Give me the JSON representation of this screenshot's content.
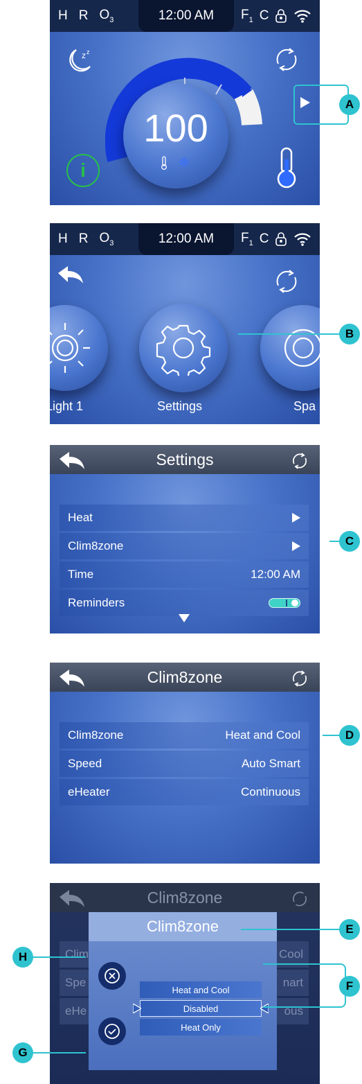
{
  "status_bar": {
    "h": "H",
    "r": "R",
    "o": "O",
    "o_sub": "3",
    "time": "12:00 AM",
    "f": "F",
    "f_sub": "1",
    "c": "C"
  },
  "screen1": {
    "temperature": "100",
    "callout": "A"
  },
  "screen2": {
    "items": [
      {
        "label": "Light 1",
        "icon": "sun-icon"
      },
      {
        "label": "Settings",
        "icon": "gear-icon"
      },
      {
        "label": "Spa",
        "icon": "spa-icon"
      }
    ],
    "callout": "B"
  },
  "screen3": {
    "title": "Settings",
    "rows": [
      {
        "label": "Heat"
      },
      {
        "label": "Clim8zone"
      },
      {
        "label": "Time",
        "value": "12:00 AM"
      },
      {
        "label": "Reminders"
      }
    ],
    "reminders_toggle": "on",
    "callout": "C"
  },
  "screen4": {
    "title": "Clim8zone",
    "rows": [
      {
        "label": "Clim8zone",
        "value": "Heat and Cool"
      },
      {
        "label": "Speed",
        "value": "Auto Smart"
      },
      {
        "label": "eHeater",
        "value": "Continuous"
      }
    ],
    "callout": "D"
  },
  "screen5": {
    "title": "Clim8zone",
    "dialog_title": "Clim8zone",
    "bg_labels": [
      "Clim",
      "Spe",
      "eHe"
    ],
    "bg_values": [
      "Cool",
      "nart",
      "ous"
    ],
    "options": [
      "Heat and Cool",
      "Disabled",
      "Heat Only"
    ],
    "selected_option": "Disabled",
    "callouts": {
      "e": "E",
      "f": "F",
      "g": "G",
      "h": "H"
    }
  },
  "colors": {
    "accent_teal": "#2fc3d0",
    "dial_blue": "#1339d8",
    "status_bar": "#16274c",
    "info_green": "#28c04a"
  }
}
